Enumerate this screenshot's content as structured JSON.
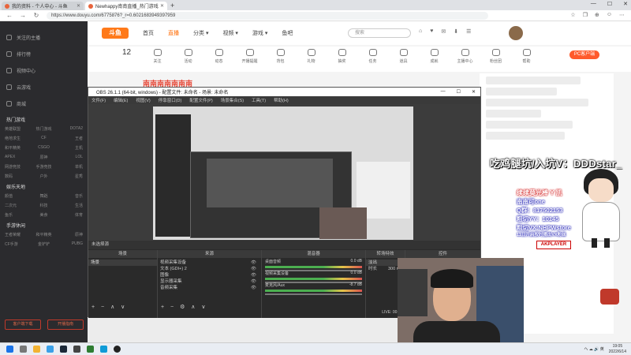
{
  "browser": {
    "tabs": [
      {
        "title": "我的资料 - 个人中心 - 斗鱼",
        "active": false
      },
      {
        "title": "Newhappy南南直播_热门游戏...",
        "active": true
      }
    ],
    "url": "https://www.douyu.com/6775876?_r=0.6021683949397959",
    "window_controls": [
      "—",
      "☐",
      "✕"
    ]
  },
  "sidebar": {
    "items": [
      "关注的主播",
      "排行榜",
      "视频中心",
      "云游戏",
      "商城"
    ],
    "section1": "热门游戏",
    "section1_tags": [
      "英雄联盟",
      "热门游戏",
      "DOTA2",
      "绝地求生",
      "CF",
      "王者",
      "和平精英",
      "CSGO",
      "主机",
      "APEX",
      "原神",
      "LOL",
      "网游竞技",
      "手游竞技",
      "单机",
      "数码",
      "户外",
      "星秀"
    ],
    "section2": "娱乐天地",
    "section2_tags": [
      "颜值",
      "舞蹈",
      "音乐",
      "二次元",
      "科技",
      "生活",
      "鱼乐",
      "美食",
      "体育"
    ],
    "section3": "手游休闲",
    "section3_tags": [
      "王者荣耀",
      "和平精英",
      "原神",
      "CF手游",
      "金铲铲",
      "PUBG"
    ],
    "buttons": [
      "客户端下载",
      "开播指南"
    ]
  },
  "topnav": {
    "logo": "斗鱼",
    "items": [
      "首页",
      "直播",
      "分类 ▾",
      "视频 ▾",
      "游戏 ▾",
      "鱼吧"
    ],
    "active_index": 1,
    "search_placeholder": "搜索",
    "icons": [
      "⌂",
      "♥",
      "✉",
      "⬇",
      "☰"
    ]
  },
  "subbar": {
    "level": "12",
    "items": [
      "关注",
      "活动",
      "动态",
      "开播提醒",
      "背包",
      "礼物",
      "抽奖",
      "任务",
      "道具",
      "成就",
      "主播中心",
      "粉丝团",
      "帮助"
    ],
    "pc_button": "PC客户端",
    "red_title": "南南南南南南南"
  },
  "obs": {
    "title": "OBS 26.1.1 (64-bit, windows) - 配置文件: 未命名 - 场景: 未命名",
    "menu": [
      "文件(F)",
      "编辑(E)",
      "视图(V)",
      "停靠窗口(D)",
      "配置文件(P)",
      "场景集合(S)",
      "工具(T)",
      "帮助(H)"
    ],
    "source_bar": "未选择源",
    "docks": {
      "scenes": {
        "header": "场景",
        "selected": "场景"
      },
      "sources": {
        "header": "来源",
        "items": [
          "视频采集设备",
          "文本 (GDI+) 2",
          "图像",
          "显示器采集",
          "音频采集"
        ]
      },
      "mixer": {
        "header": "混音器",
        "tracks": [
          {
            "name": "桌面音频",
            "db": "0.0 dB"
          },
          {
            "name": "视频采集设备",
            "db": "0.0 dB"
          },
          {
            "name": "麦克风/Aux",
            "db": "-8.7 dB"
          }
        ]
      },
      "transitions": {
        "header": "转场特效",
        "type": "淡出",
        "duration_label": "时长",
        "duration": "300 ms"
      },
      "controls": {
        "header": "控件",
        "buttons": [
          "开始推流",
          "开始录制",
          "工作室模式",
          "设置",
          "退出"
        ]
      }
    },
    "status": "LIVE: 00:00:00   REC: 00:00:00   CPU: 3.1%, 30.00 fps"
  },
  "overlay": {
    "title": "吃鸡腿坑/入坑V：DDDstar_",
    "box_header": "续续莫光棒 Y 凯",
    "lines": [
      "南南可one",
      "Q群：817502153",
      "粗切YY：10145",
      "粗切VX:NHPWstore"
    ],
    "small": "11日开启按时播出VX粉丝",
    "brand": "AKPLAYER"
  },
  "taskbar": {
    "time": "19:05",
    "date": "2022/6/14",
    "tray": "ヘ ☁ 🔊 英"
  }
}
